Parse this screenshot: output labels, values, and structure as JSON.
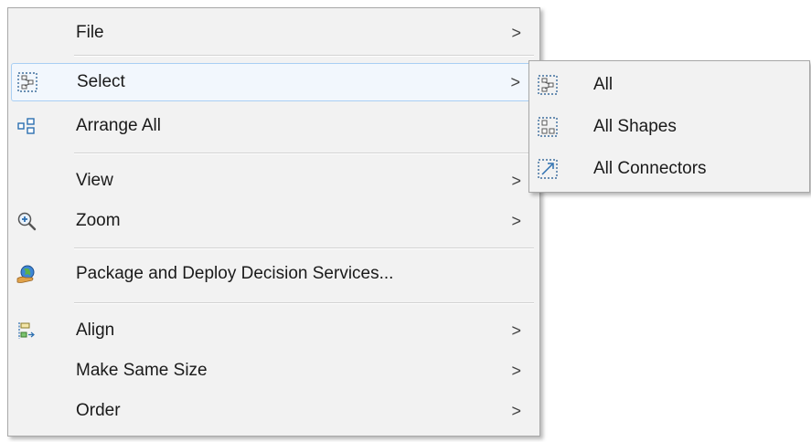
{
  "context_menu": {
    "items": [
      {
        "label": "File",
        "arrow": ">"
      },
      {
        "label": "Select",
        "arrow": ">",
        "icon": "select-dotted-shapes-icon"
      },
      {
        "label": "Arrange All",
        "icon": "arrange-all-icon"
      },
      {
        "label": "View",
        "arrow": ">"
      },
      {
        "label": "Zoom",
        "arrow": ">",
        "icon": "zoom-in-icon"
      },
      {
        "label": "Package and Deploy Decision Services...",
        "icon": "deploy-globe-hand-icon"
      },
      {
        "label": "Align",
        "arrow": ">",
        "icon": "align-icon"
      },
      {
        "label": "Make Same Size",
        "arrow": ">"
      },
      {
        "label": "Order",
        "arrow": ">"
      }
    ]
  },
  "submenu": {
    "items": [
      {
        "label": "All",
        "icon": "select-all-icon"
      },
      {
        "label": "All Shapes",
        "icon": "select-all-shapes-icon"
      },
      {
        "label": "All Connectors",
        "icon": "select-all-connectors-icon"
      }
    ]
  },
  "colors": {
    "menu_background": "#f2f2f2",
    "highlight_background": "#f2f7fd",
    "highlight_border": "#a9cff3",
    "separator": "#d3d3d3"
  }
}
